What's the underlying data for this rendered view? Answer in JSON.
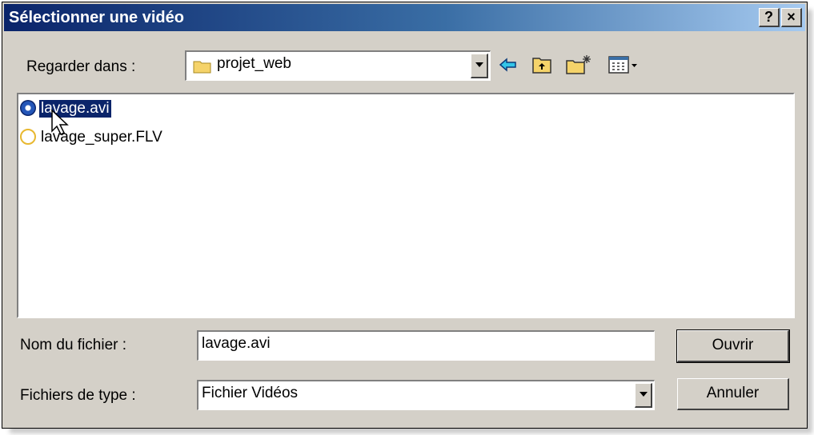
{
  "window": {
    "title": "Sélectionner une vidéo",
    "help_label": "?",
    "close_label": "×"
  },
  "look_in": {
    "label": "Regarder dans :",
    "folder": "projet_web"
  },
  "toolbar": {
    "icons": [
      "back-icon",
      "up-folder-icon",
      "new-folder-icon",
      "view-menu-icon"
    ]
  },
  "files": [
    {
      "name": "lavage.avi",
      "icon": "avi-video-icon",
      "selected": true
    },
    {
      "name": "lavage_super.FLV",
      "icon": "flv-file-icon",
      "selected": false
    }
  ],
  "filename": {
    "label": "Nom du fichier :",
    "value": "lavage.avi"
  },
  "filetype": {
    "label": "Fichiers de type :",
    "value": "Fichier Vidéos"
  },
  "buttons": {
    "open": "Ouvrir",
    "cancel": "Annuler"
  },
  "colors": {
    "selection": "#0a246a",
    "face": "#d4d0c8"
  }
}
